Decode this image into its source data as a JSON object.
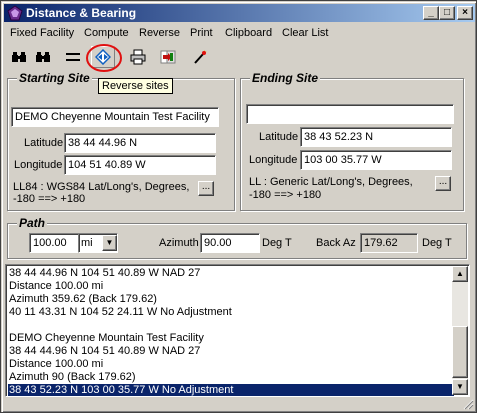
{
  "window": {
    "title": "Distance & Bearing",
    "icon": "app-icon",
    "controls": {
      "minimize": "_",
      "maximize": "□",
      "close": "×"
    }
  },
  "menu": [
    "Fixed Facility",
    "Compute",
    "Reverse",
    "Print",
    "Clipboard",
    "Clear List"
  ],
  "toolbar": {
    "tools": [
      "binoculars-icon",
      "binoculars-icon",
      "equals-icon",
      "reverse-sites-icon",
      "printer-icon",
      "swap-icon",
      "wand-icon"
    ],
    "tooltip": "Reverse sites",
    "highlight_color": "#e01010"
  },
  "starting_site": {
    "title": "Starting Site",
    "name": "DEMO Cheyenne Mountain Test Facility",
    "latitude_label": "Latitude",
    "latitude": "38 44 44.96 N",
    "longitude_label": "Longitude",
    "longitude": "104 51 40.89 W",
    "datum_line1": "LL84 : WGS84 Lat/Long's, Degrees,",
    "datum_line2": "-180 ==> +180",
    "browse": "..."
  },
  "ending_site": {
    "title": "Ending Site",
    "name": "",
    "latitude_label": "Latitude",
    "latitude": "38 43 52.23 N",
    "longitude_label": "Longitude",
    "longitude": "103 00 35.77 W",
    "datum_line1": "LL : Generic Lat/Long's, Degrees,",
    "datum_line2": "-180 ==> +180",
    "browse": "..."
  },
  "path": {
    "title": "Path",
    "distance": "100.00",
    "unit": "mi",
    "azimuth_label": "Azimuth",
    "azimuth": "90.00",
    "azimuth_unit": "Deg T",
    "back_az_label": "Back Az",
    "back_az": "179.62",
    "back_az_unit": "Deg T"
  },
  "results": [
    "38 44 44.96 N 104 51 40.89 W NAD 27",
    "Distance 100.00 mi",
    "Azimuth  359.62 (Back 179.62)",
    "40 11 43.31 N 104 52 24.11 W No Adjustment",
    "",
    "DEMO Cheyenne Mountain Test Facility",
    "38 44 44.96 N 104 51 40.89 W NAD 27",
    "Distance 100.00 mi",
    "Azimuth  90 (Back 179.62)",
    "38 43 52.23 N 103 00 35.77 W No Adjustment"
  ],
  "selected_index": 9
}
